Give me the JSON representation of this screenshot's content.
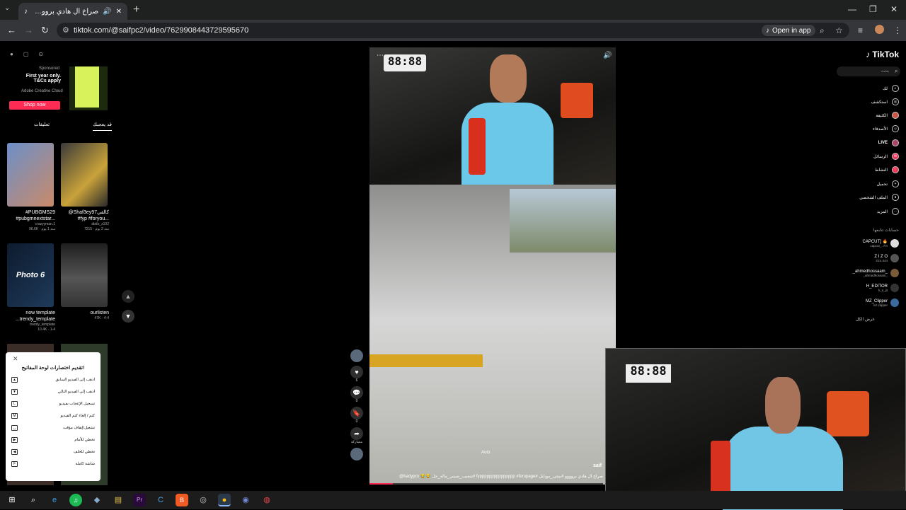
{
  "browser": {
    "tab_title": "صراخ ال هادي بروووو #ببجي...",
    "url": "tiktok.com/@saifpc2/video/7629908443729595670",
    "open_in_app": "Open in app",
    "new_tab": "+",
    "window_controls": [
      "—",
      "❐",
      "✕"
    ]
  },
  "ad": {
    "sponsored": "Sponsored",
    "headline": "First year only. T&Cs apply",
    "advertiser": "Adobe Creative Cloud",
    "cta": "Shop now"
  },
  "left_tabs": [
    "تعليقات",
    "قد يعجبك"
  ],
  "grid": [
    {
      "caption": "#PUBGMS29 #pubgmnextstar...",
      "author": "crazyyman.1",
      "meta": "96.6K · منذ 1 يوم"
    },
    {
      "caption": "@Shaf3ey97كالفي #fyp #foryou...",
      "author": "abdo_z102",
      "meta": "7215 · منذ 2 يوم"
    },
    {
      "caption": "now template ...trendy_template",
      "author": "trendy_template",
      "meta": "10.4K · 1-4",
      "overlay": "Photo 6"
    },
    {
      "caption": "ourlisten",
      "author": "",
      "meta": "47K · 4-4"
    }
  ],
  "shortcuts": {
    "title": "تقديم اختصارات لوحة المفاتيح!",
    "items": [
      {
        "label": "اذهب إلى الفيديو السابق",
        "key": "▲"
      },
      {
        "label": "اذهب إلى الفيديو التالي",
        "key": "▼"
      },
      {
        "label": "تسجيل الإعجاب بفيديو",
        "key": "L"
      },
      {
        "label": "كتم / إلغاء كتم الفيديو",
        "key": "M"
      },
      {
        "label": "تشغيل/إيقاف مؤقت",
        "key": "␣"
      },
      {
        "label": "تخطي للأمام",
        "key": "▶"
      },
      {
        "label": "تخطي للخلف",
        "key": "◀"
      },
      {
        "label": "شاشة كاملة",
        "key": "F"
      }
    ]
  },
  "video": {
    "caption": "صراخ ال هادي بروووو #ببجي_موبايل #fyppppppppppppppp #forupage #شعيب_صيني_ماله_حل 😂😂 hadypro@",
    "progress": 0.1,
    "clock": "88:88",
    "hud_label": "Auto",
    "streamer": "saif"
  },
  "actions": [
    {
      "icon": "♥",
      "count": "6"
    },
    {
      "icon": "💬",
      "count": "0"
    },
    {
      "icon": "🔖",
      "count": "0"
    },
    {
      "icon": "➦",
      "count": "مشاركة"
    }
  ],
  "nav": {
    "logo": "TikTok",
    "search_placeholder": "بحث",
    "items": [
      "لك",
      "استكشف",
      "الكثيفة",
      "الأصدقاء",
      "LIVE",
      "الرسائل",
      "النشاط",
      "تحميل",
      "الملف الشخصي",
      "المزيد"
    ],
    "following_title": "حسابات تتابعها",
    "following": [
      {
        "name": "CAPCUT] 🔥",
        "handle": "capcut_..7m"
      },
      {
        "name": "Z I Z O",
        "handle": "zizo.444"
      },
      {
        "name": "_ahmedhossaam_",
        "handle": "_ahmedhossam_"
      },
      {
        "name": "H_EDITOR",
        "handle": "h_e_jit"
      },
      {
        "name": "MZ_Clipper",
        "handle": "mz.clipper"
      }
    ],
    "see_more": "عرض الكل"
  },
  "taskbar": [
    "⊞",
    "⌕",
    "e",
    "♫",
    "◆",
    "▤",
    "Pr",
    "C",
    "B",
    "◎",
    "●",
    "◉",
    "◍"
  ]
}
